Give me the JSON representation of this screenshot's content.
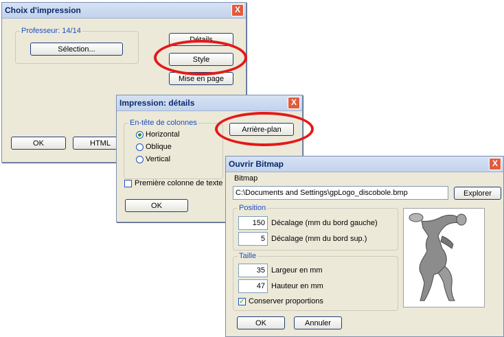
{
  "choix": {
    "title": "Choix d'impression",
    "close_label": "X",
    "group_label": "Professeur: 14/14",
    "selection_label": "Sélection...",
    "details_label": "Détails",
    "style_label": "Style",
    "mise_label": "Mise en page",
    "ok_label": "OK",
    "html_label": "HTML"
  },
  "impression": {
    "title": "Impression: détails",
    "close_label": "X",
    "group_label": "En-tête de colonnes",
    "radios": [
      {
        "label": "Horizontal",
        "checked": true
      },
      {
        "label": "Oblique",
        "checked": false
      },
      {
        "label": "Vertical",
        "checked": false
      }
    ],
    "arriere_label": "Arrière-plan",
    "first_col_label": "Première colonne de texte su",
    "ok_label": "OK"
  },
  "bitmap": {
    "title": "Ouvrir Bitmap",
    "close_label": "X",
    "bitmap_label": "Bitmap",
    "path_value": "C:\\Documents and Settings\\gpLogo_discobole.bmp",
    "explorer_label": "Explorer",
    "position_label": "Position",
    "decalage_gauche_value": "150",
    "decalage_gauche_label": "Décalage (mm du bord gauche)",
    "decalage_sup_value": "5",
    "decalage_sup_label": "Décalage (mm du bord sup.)",
    "taille_label": "Taille",
    "largeur_value": "35",
    "largeur_label": "Largeur en mm",
    "hauteur_value": "47",
    "hauteur_label": "Hauteur en mm",
    "conserver_label": "Conserver proportions",
    "conserver_checked": true,
    "ok_label": "OK",
    "annuler_label": "Annuler"
  },
  "colors": {
    "highlight_ring": "#e41919",
    "title_text": "#0b2a6b",
    "dialog_bg": "#ece9d8"
  },
  "icons": [
    "close-icon",
    "radio-icon",
    "checkbox-icon",
    "discobolus-image"
  ]
}
